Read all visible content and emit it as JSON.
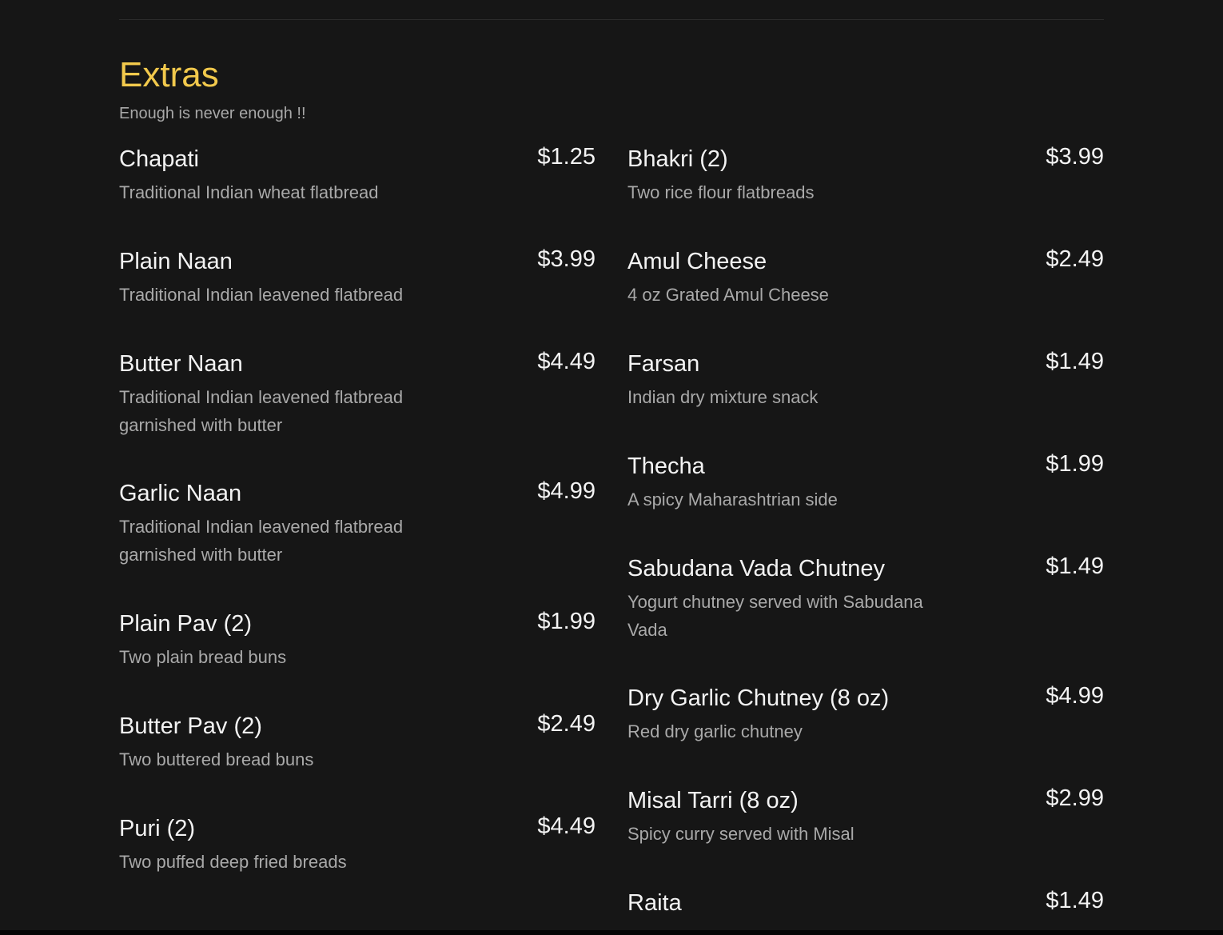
{
  "section": {
    "title": "Extras",
    "subtitle": "Enough is never enough !!"
  },
  "left_items": [
    {
      "name": "Chapati",
      "desc": "Traditional Indian wheat flatbread",
      "price": "$1.25"
    },
    {
      "name": "Plain Naan",
      "desc": "Traditional Indian leavened flatbread",
      "price": "$3.99"
    },
    {
      "name": "Butter Naan",
      "desc": "Traditional Indian leavened flatbread garnished with butter",
      "price": "$4.49"
    },
    {
      "name": "Garlic Naan",
      "desc": "Traditional Indian leavened flatbread garnished with butter",
      "price": "$4.99"
    },
    {
      "name": "Plain Pav (2)",
      "desc": "Two plain bread buns",
      "price": "$1.99"
    },
    {
      "name": "Butter Pav (2)",
      "desc": "Two buttered bread buns",
      "price": "$2.49"
    },
    {
      "name": "Puri (2)",
      "desc": "Two puffed deep fried breads",
      "price": "$4.49"
    }
  ],
  "right_items": [
    {
      "name": "Bhakri (2)",
      "desc": "Two rice flour flatbreads",
      "price": "$3.99"
    },
    {
      "name": "Amul Cheese",
      "desc": "4 oz Grated Amul Cheese",
      "price": "$2.49"
    },
    {
      "name": "Farsan",
      "desc": "Indian dry mixture snack",
      "price": "$1.49"
    },
    {
      "name": "Thecha",
      "desc": "A spicy Maharashtrian side",
      "price": "$1.99"
    },
    {
      "name": "Sabudana Vada Chutney",
      "desc": "Yogurt chutney served with Sabudana Vada",
      "price": "$1.49"
    },
    {
      "name": "Dry Garlic Chutney (8 oz)",
      "desc": "Red dry garlic chutney",
      "price": "$4.99"
    },
    {
      "name": "Misal Tarri (8 oz)",
      "desc": "Spicy curry served with Misal",
      "price": "$2.99"
    },
    {
      "name": "Raita",
      "desc": "",
      "price": "$1.49"
    }
  ],
  "colors": {
    "background": "#161616",
    "title_accent": "#f2c94c",
    "text_primary": "#f3f3f3",
    "text_secondary": "#a9a9a9"
  }
}
